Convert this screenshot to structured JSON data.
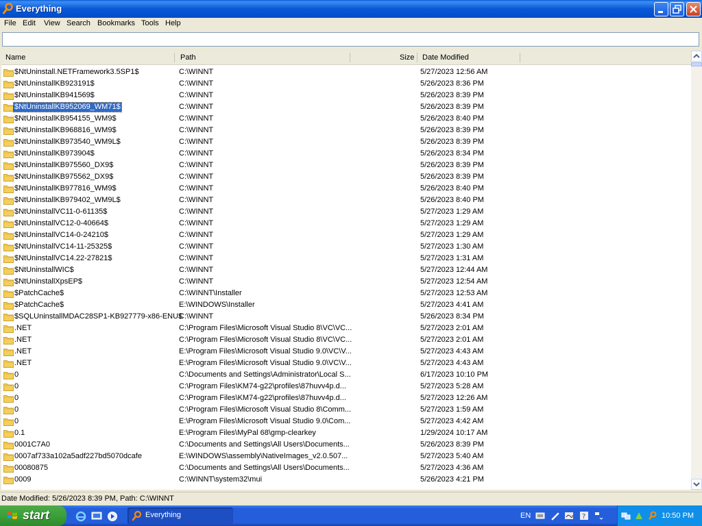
{
  "window": {
    "title": "Everything"
  },
  "menu": [
    "File",
    "Edit",
    "View",
    "Search",
    "Bookmarks",
    "Tools",
    "Help"
  ],
  "search": {
    "value": "",
    "placeholder": ""
  },
  "columns": {
    "name": "Name",
    "path": "Path",
    "size": "Size",
    "date": "Date Modified"
  },
  "rows": [
    {
      "name": "$NtUninstall.NETFramework3.5SP1$",
      "path": "C:\\WINNT",
      "date": "5/27/2023 12:56 AM"
    },
    {
      "name": "$NtUninstallKB923191$",
      "path": "C:\\WINNT",
      "date": "5/26/2023 8:36 PM"
    },
    {
      "name": "$NtUninstallKB941569$",
      "path": "C:\\WINNT",
      "date": "5/26/2023 8:39 PM"
    },
    {
      "name": "$NtUninstallKB952069_WM71$",
      "path": "C:\\WINNT",
      "date": "5/26/2023 8:39 PM",
      "selected": true
    },
    {
      "name": "$NtUninstallKB954155_WM9$",
      "path": "C:\\WINNT",
      "date": "5/26/2023 8:40 PM"
    },
    {
      "name": "$NtUninstallKB968816_WM9$",
      "path": "C:\\WINNT",
      "date": "5/26/2023 8:39 PM"
    },
    {
      "name": "$NtUninstallKB973540_WM9L$",
      "path": "C:\\WINNT",
      "date": "5/26/2023 8:39 PM"
    },
    {
      "name": "$NtUninstallKB973904$",
      "path": "C:\\WINNT",
      "date": "5/26/2023 8:34 PM"
    },
    {
      "name": "$NtUninstallKB975560_DX9$",
      "path": "C:\\WINNT",
      "date": "5/26/2023 8:39 PM"
    },
    {
      "name": "$NtUninstallKB975562_DX9$",
      "path": "C:\\WINNT",
      "date": "5/26/2023 8:39 PM"
    },
    {
      "name": "$NtUninstallKB977816_WM9$",
      "path": "C:\\WINNT",
      "date": "5/26/2023 8:40 PM"
    },
    {
      "name": "$NtUninstallKB979402_WM9L$",
      "path": "C:\\WINNT",
      "date": "5/26/2023 8:40 PM"
    },
    {
      "name": "$NtUninstallVC11-0-61135$",
      "path": "C:\\WINNT",
      "date": "5/27/2023 1:29 AM"
    },
    {
      "name": "$NtUninstallVC12-0-40664$",
      "path": "C:\\WINNT",
      "date": "5/27/2023 1:29 AM"
    },
    {
      "name": "$NtUninstallVC14-0-24210$",
      "path": "C:\\WINNT",
      "date": "5/27/2023 1:29 AM"
    },
    {
      "name": "$NtUninstallVC14-11-25325$",
      "path": "C:\\WINNT",
      "date": "5/27/2023 1:30 AM"
    },
    {
      "name": "$NtUninstallVC14.22-27821$",
      "path": "C:\\WINNT",
      "date": "5/27/2023 1:31 AM"
    },
    {
      "name": "$NtUninstallWIC$",
      "path": "C:\\WINNT",
      "date": "5/27/2023 12:44 AM"
    },
    {
      "name": "$NtUninstallXpsEP$",
      "path": "C:\\WINNT",
      "date": "5/27/2023 12:54 AM"
    },
    {
      "name": "$PatchCache$",
      "path": "C:\\WINNT\\Installer",
      "date": "5/27/2023 12:53 AM"
    },
    {
      "name": "$PatchCache$",
      "path": "E:\\WINDOWS\\Installer",
      "date": "5/27/2023 4:41 AM"
    },
    {
      "name": "$SQLUninstallMDAC28SP1-KB927779-x86-ENU$",
      "path": "C:\\WINNT",
      "date": "5/26/2023 8:34 PM"
    },
    {
      "name": ".NET",
      "path": "C:\\Program Files\\Microsoft Visual Studio 8\\VC\\VC...",
      "date": "5/27/2023 2:01 AM"
    },
    {
      "name": ".NET",
      "path": "C:\\Program Files\\Microsoft Visual Studio 8\\VC\\VC...",
      "date": "5/27/2023 2:01 AM"
    },
    {
      "name": ".NET",
      "path": "E:\\Program Files\\Microsoft Visual Studio 9.0\\VC\\V...",
      "date": "5/27/2023 4:43 AM"
    },
    {
      "name": ".NET",
      "path": "E:\\Program Files\\Microsoft Visual Studio 9.0\\VC\\V...",
      "date": "5/27/2023 4:43 AM"
    },
    {
      "name": "0",
      "path": "C:\\Documents and Settings\\Administrator\\Local S...",
      "date": "6/17/2023 10:10 PM"
    },
    {
      "name": "0",
      "path": "C:\\Program Files\\KM74-g22\\profiles\\87huvv4p.d...",
      "date": "5/27/2023 5:28 AM"
    },
    {
      "name": "0",
      "path": "C:\\Program Files\\KM74-g22\\profiles\\87huvv4p.d...",
      "date": "5/27/2023 12:26 AM"
    },
    {
      "name": "0",
      "path": "C:\\Program Files\\Microsoft Visual Studio 8\\Comm...",
      "date": "5/27/2023 1:59 AM"
    },
    {
      "name": "0",
      "path": "E:\\Program Files\\Microsoft Visual Studio 9.0\\Com...",
      "date": "5/27/2023 4:42 AM"
    },
    {
      "name": "0.1",
      "path": "E:\\Program Files\\MyPal 68\\gmp-clearkey",
      "date": "1/29/2024 10:17 AM"
    },
    {
      "name": "0001C7A0",
      "path": "C:\\Documents and Settings\\All Users\\Documents...",
      "date": "5/26/2023 8:39 PM"
    },
    {
      "name": "0007af733a102a5adf227bd5070dcafe",
      "path": "E:\\WINDOWS\\assembly\\NativeImages_v2.0.507...",
      "date": "5/27/2023 5:40 AM"
    },
    {
      "name": "00080875",
      "path": "C:\\Documents and Settings\\All Users\\Documents...",
      "date": "5/27/2023 4:36 AM"
    },
    {
      "name": "0009",
      "path": "C:\\WINNT\\system32\\mui",
      "date": "5/26/2023 4:21 PM"
    }
  ],
  "status": {
    "text": "Date Modified: 5/26/2023 8:39 PM, Path: C:\\WINNT"
  },
  "taskbar": {
    "start_label": "start",
    "task_label": "Everything",
    "lang": "EN",
    "clock": "10:50 PM"
  },
  "colors": {
    "selection": "#316ac5",
    "titlebar": "#0858d6",
    "folder": "#f4cf5a",
    "start_green": "#3c9f3a"
  }
}
